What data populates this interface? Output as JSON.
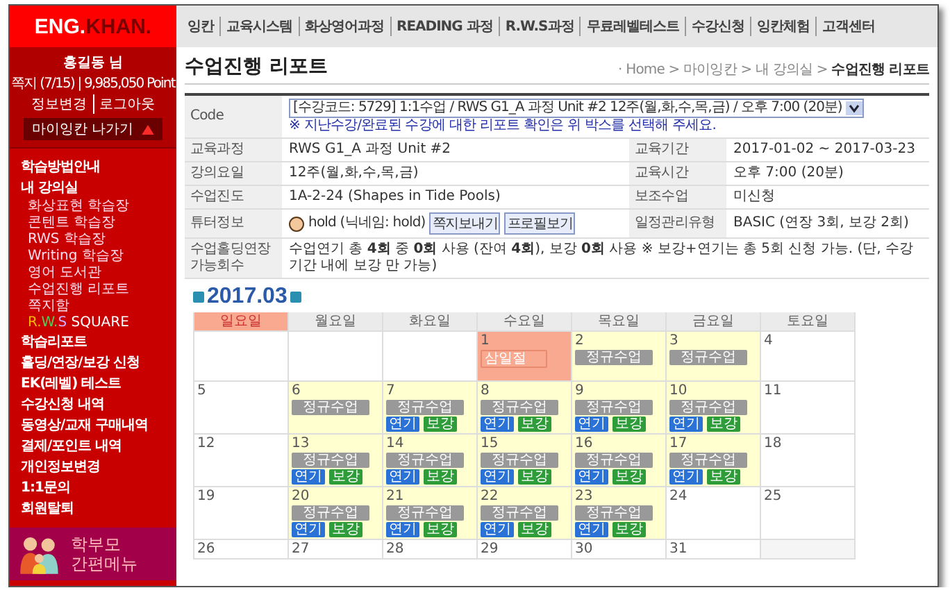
{
  "logo": {
    "part_1": "ENG.",
    "part_2": "KHAN."
  },
  "nav": [
    "잉칸",
    "교육시스템",
    "화상영어과정",
    "READING 과정",
    "R.W.S과정",
    "무료레벨테스트",
    "수강신청",
    "잉칸체험",
    "고객센터"
  ],
  "user": {
    "name": "홍길동 님",
    "stats": "쪽지 (7/15)  |  9,985,050 Point",
    "links": [
      "정보변경",
      "로그아웃"
    ],
    "exit_button": "마이잉칸 나가기"
  },
  "sidebar": {
    "items": [
      {
        "label": "학습방법안내"
      },
      {
        "label": "내 강의실",
        "children": [
          {
            "label": "화상표현 학습장"
          },
          {
            "label": "콘텐트 학습장"
          },
          {
            "label": "RWS 학습장"
          },
          {
            "label": "Writing 학습장"
          },
          {
            "label": "영어 도서관"
          },
          {
            "label": "수업진행 리포트"
          },
          {
            "label": "쪽지함"
          },
          {
            "segments": [
              {
                "text": "R.",
                "color": "#f2b705"
              },
              {
                "text": "W.",
                "color": "#5cc85c"
              },
              {
                "text": "S",
                "color": "#d2b0ff"
              },
              {
                "text": " SQUARE",
                "color": "#ffffff"
              }
            ]
          }
        ]
      },
      {
        "label": "학습리포트"
      },
      {
        "label": "홀딩/연장/보강 신청"
      },
      {
        "label": "EK(레벨) 테스트"
      },
      {
        "label": "수강신청 내역"
      },
      {
        "label": "동영상/교재 구매내역"
      },
      {
        "label": "결제/포인트 내역"
      },
      {
        "label": "개인정보변경"
      },
      {
        "label": "1:1문의"
      },
      {
        "label": "회원탈퇴"
      }
    ],
    "banner": {
      "line_1": "학부모",
      "line_2": "간편메뉴"
    }
  },
  "page": {
    "title": "수업진행 리포트",
    "breadcrumb": "· Home > 마이잉칸 > 내 강의실 > **수업진행 리포트**"
  },
  "info_rows": [
    {
      "kind": "code",
      "label": "Code",
      "select": "[수강코드: 5729] 1:1수업 / RWS G1_A 과정 Unit #2 12주(월,화,수,목,금) / 오후 7:00 (20분)",
      "note": "※ 지난수강/완료된 수강에 대한 리포트 확인은 위 박스를 선택해 주세요."
    },
    {
      "kind": "pair",
      "label": "교육과정",
      "value": "RWS G1_A 과정 Unit #2",
      "label_2": "교육기간",
      "value_2": "2017-01-02 ~ 2017-03-23"
    },
    {
      "kind": "pair",
      "label": "강의요일",
      "value": "12주(월,화,수,목,금)",
      "label_2": "교육시간",
      "value_2": "오후 7:00 (20분)"
    },
    {
      "kind": "pair",
      "label": "수업진도",
      "value": "1A-2-24 (Shapes in Tide Pools)",
      "label_2": "보조수업",
      "value_2": "미신청"
    },
    {
      "kind": "tutor",
      "label": "튜터정보",
      "value": "hold (닉네임: hold)",
      "buttons": [
        "쪽지보내기",
        "프로필보기"
      ],
      "label_2": "일정관리유형",
      "value_2": "BASIC (연장 3회, 보강 2회)"
    },
    {
      "kind": "wide",
      "label": "수업홀딩연장 가능회수",
      "value": "수업연기 총 **4회** 중 **0회** 사용 (잔여 **4회**), 보강 **0회** 사용 ※ 보강+연기는 총 5회 신청 가능. (단, 수강기간 내에 보강 만 가능)"
    }
  ],
  "calendar": {
    "month": "2017.03",
    "weekdays": [
      {
        "label": "일요일",
        "kind": "sunday"
      },
      {
        "label": "월요일",
        "kind": "weekday"
      },
      {
        "label": "화요일",
        "kind": "weekday"
      },
      {
        "label": "수요일",
        "kind": "weekday"
      },
      {
        "label": "목요일",
        "kind": "weekday"
      },
      {
        "label": "금요일",
        "kind": "weekday"
      },
      {
        "label": "토요일",
        "kind": "weekday"
      }
    ],
    "weeks": [
      [
        {
          "kind": "blank"
        },
        {
          "kind": "blank"
        },
        {
          "kind": "blank"
        },
        {
          "kind": "holiday",
          "day": "1",
          "events": [
            {
              "label": "삼일절",
              "kind": "holiday"
            }
          ]
        },
        {
          "kind": "class",
          "day": "2",
          "events": [
            {
              "label": "정규수업",
              "kind": "regular"
            }
          ]
        },
        {
          "kind": "class",
          "day": "3",
          "events": [
            {
              "label": "정규수업",
              "kind": "regular"
            }
          ]
        },
        {
          "kind": "plain",
          "day": "4"
        }
      ],
      [
        {
          "kind": "plain",
          "day": "5"
        },
        {
          "kind": "class",
          "day": "6",
          "events": [
            {
              "label": "정규수업",
              "kind": "regular"
            }
          ]
        },
        {
          "kind": "class",
          "day": "7",
          "events": [
            {
              "label": "정규수업",
              "kind": "regular"
            }
          ],
          "actions": [
            {
              "label": "연기",
              "kind": "postpone"
            },
            {
              "label": "보강",
              "kind": "makeup"
            }
          ]
        },
        {
          "kind": "class",
          "day": "8",
          "events": [
            {
              "label": "정규수업",
              "kind": "regular"
            }
          ],
          "actions": [
            {
              "label": "연기",
              "kind": "postpone"
            },
            {
              "label": "보강",
              "kind": "makeup"
            }
          ]
        },
        {
          "kind": "class",
          "day": "9",
          "events": [
            {
              "label": "정규수업",
              "kind": "regular"
            }
          ],
          "actions": [
            {
              "label": "연기",
              "kind": "postpone"
            },
            {
              "label": "보강",
              "kind": "makeup"
            }
          ]
        },
        {
          "kind": "class",
          "day": "10",
          "events": [
            {
              "label": "정규수업",
              "kind": "regular"
            }
          ],
          "actions": [
            {
              "label": "연기",
              "kind": "postpone"
            },
            {
              "label": "보강",
              "kind": "makeup"
            }
          ]
        },
        {
          "kind": "plain",
          "day": "11"
        }
      ],
      [
        {
          "kind": "plain",
          "day": "12"
        },
        {
          "kind": "class",
          "day": "13",
          "events": [
            {
              "label": "정규수업",
              "kind": "regular"
            }
          ],
          "actions": [
            {
              "label": "연기",
              "kind": "postpone"
            },
            {
              "label": "보강",
              "kind": "makeup"
            }
          ]
        },
        {
          "kind": "class",
          "day": "14",
          "events": [
            {
              "label": "정규수업",
              "kind": "regular"
            }
          ],
          "actions": [
            {
              "label": "연기",
              "kind": "postpone"
            },
            {
              "label": "보강",
              "kind": "makeup"
            }
          ]
        },
        {
          "kind": "class",
          "day": "15",
          "events": [
            {
              "label": "정규수업",
              "kind": "regular"
            }
          ],
          "actions": [
            {
              "label": "연기",
              "kind": "postpone"
            },
            {
              "label": "보강",
              "kind": "makeup"
            }
          ]
        },
        {
          "kind": "class",
          "day": "16",
          "events": [
            {
              "label": "정규수업",
              "kind": "regular"
            }
          ],
          "actions": [
            {
              "label": "연기",
              "kind": "postpone"
            },
            {
              "label": "보강",
              "kind": "makeup"
            }
          ]
        },
        {
          "kind": "class",
          "day": "17",
          "events": [
            {
              "label": "정규수업",
              "kind": "regular"
            }
          ],
          "actions": [
            {
              "label": "연기",
              "kind": "postpone"
            },
            {
              "label": "보강",
              "kind": "makeup"
            }
          ]
        },
        {
          "kind": "plain",
          "day": "18"
        }
      ],
      [
        {
          "kind": "plain",
          "day": "19"
        },
        {
          "kind": "class",
          "day": "20",
          "events": [
            {
              "label": "정규수업",
              "kind": "regular"
            }
          ],
          "actions": [
            {
              "label": "연기",
              "kind": "postpone"
            },
            {
              "label": "보강",
              "kind": "makeup"
            }
          ]
        },
        {
          "kind": "class",
          "day": "21",
          "events": [
            {
              "label": "정규수업",
              "kind": "regular"
            }
          ],
          "actions": [
            {
              "label": "연기",
              "kind": "postpone"
            },
            {
              "label": "보강",
              "kind": "makeup"
            }
          ]
        },
        {
          "kind": "class",
          "day": "22",
          "events": [
            {
              "label": "정규수업",
              "kind": "regular"
            }
          ],
          "actions": [
            {
              "label": "연기",
              "kind": "postpone"
            },
            {
              "label": "보강",
              "kind": "makeup"
            }
          ]
        },
        {
          "kind": "class",
          "day": "23",
          "events": [
            {
              "label": "정규수업",
              "kind": "regular"
            }
          ],
          "actions": [
            {
              "label": "연기",
              "kind": "postpone"
            },
            {
              "label": "보강",
              "kind": "makeup"
            }
          ]
        },
        {
          "kind": "plain",
          "day": "24"
        },
        {
          "kind": "plain",
          "day": "25"
        }
      ],
      [
        {
          "kind": "plain",
          "day": "26"
        },
        {
          "kind": "plain",
          "day": "27"
        },
        {
          "kind": "plain",
          "day": "28"
        },
        {
          "kind": "plain",
          "day": "29"
        },
        {
          "kind": "plain",
          "day": "30"
        },
        {
          "kind": "plain",
          "day": "31"
        },
        {
          "kind": "empty"
        }
      ]
    ]
  }
}
